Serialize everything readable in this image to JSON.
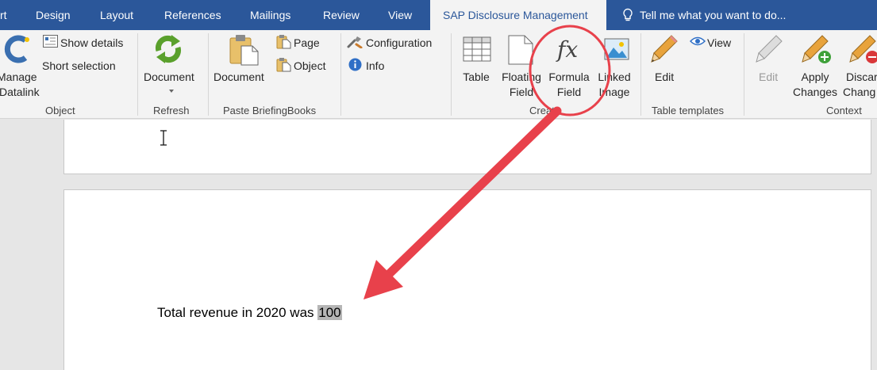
{
  "tabs": [
    {
      "label": "rt"
    },
    {
      "label": "Design"
    },
    {
      "label": "Layout"
    },
    {
      "label": "References"
    },
    {
      "label": "Mailings"
    },
    {
      "label": "Review"
    },
    {
      "label": "View"
    },
    {
      "label": "SAP Disclosure Management"
    }
  ],
  "active_tab": "SAP Disclosure Management",
  "tell_me": "Tell me what you want to do...",
  "ribbon": {
    "object": {
      "manage_line1": "Manage",
      "manage_line2": "Datalink",
      "show_details": "Show details",
      "short_selection": "Short selection",
      "group_label": "Object"
    },
    "refresh": {
      "document": "Document",
      "group_label": "Refresh"
    },
    "paste": {
      "document": "Document",
      "page": "Page",
      "object": "Object",
      "group_label": "Paste BriefingBooks"
    },
    "config": {
      "configuration": "Configuration",
      "info": "Info"
    },
    "create": {
      "table": "Table",
      "floating_line1": "Floating",
      "floating_line2": "Field",
      "formula_line1": "Formula",
      "formula_line2": "Field",
      "linked_line1": "Linked",
      "linked_line2": "Image",
      "group_label": "Create"
    },
    "table_templates": {
      "edit": "Edit",
      "view": "View",
      "group_label": "Table templates"
    },
    "context": {
      "edit": "Edit",
      "apply_line1": "Apply",
      "apply_line2": "Changes",
      "discard_line1": "Discar",
      "discard_line2": "Chang",
      "group_label": "Context"
    }
  },
  "document": {
    "sentence": "Total revenue in 2020 was ",
    "field_value": "100"
  },
  "colors": {
    "tab_bar": "#2b579a",
    "ribbon": "#f3f3f3",
    "annotation_red": "#e8414b"
  },
  "icons": [
    "manage-datalink-icon",
    "show-details-icon",
    "refresh-icon",
    "paste-document-icon",
    "paste-page-icon",
    "paste-object-icon",
    "configuration-icon",
    "info-icon",
    "table-icon",
    "floating-field-icon",
    "formula-fx-icon",
    "linked-image-icon",
    "edit-pencil-icon",
    "view-eye-icon",
    "apply-changes-icon",
    "discard-changes-icon",
    "text-cursor-icon",
    "annotation-arrow-icon"
  ]
}
